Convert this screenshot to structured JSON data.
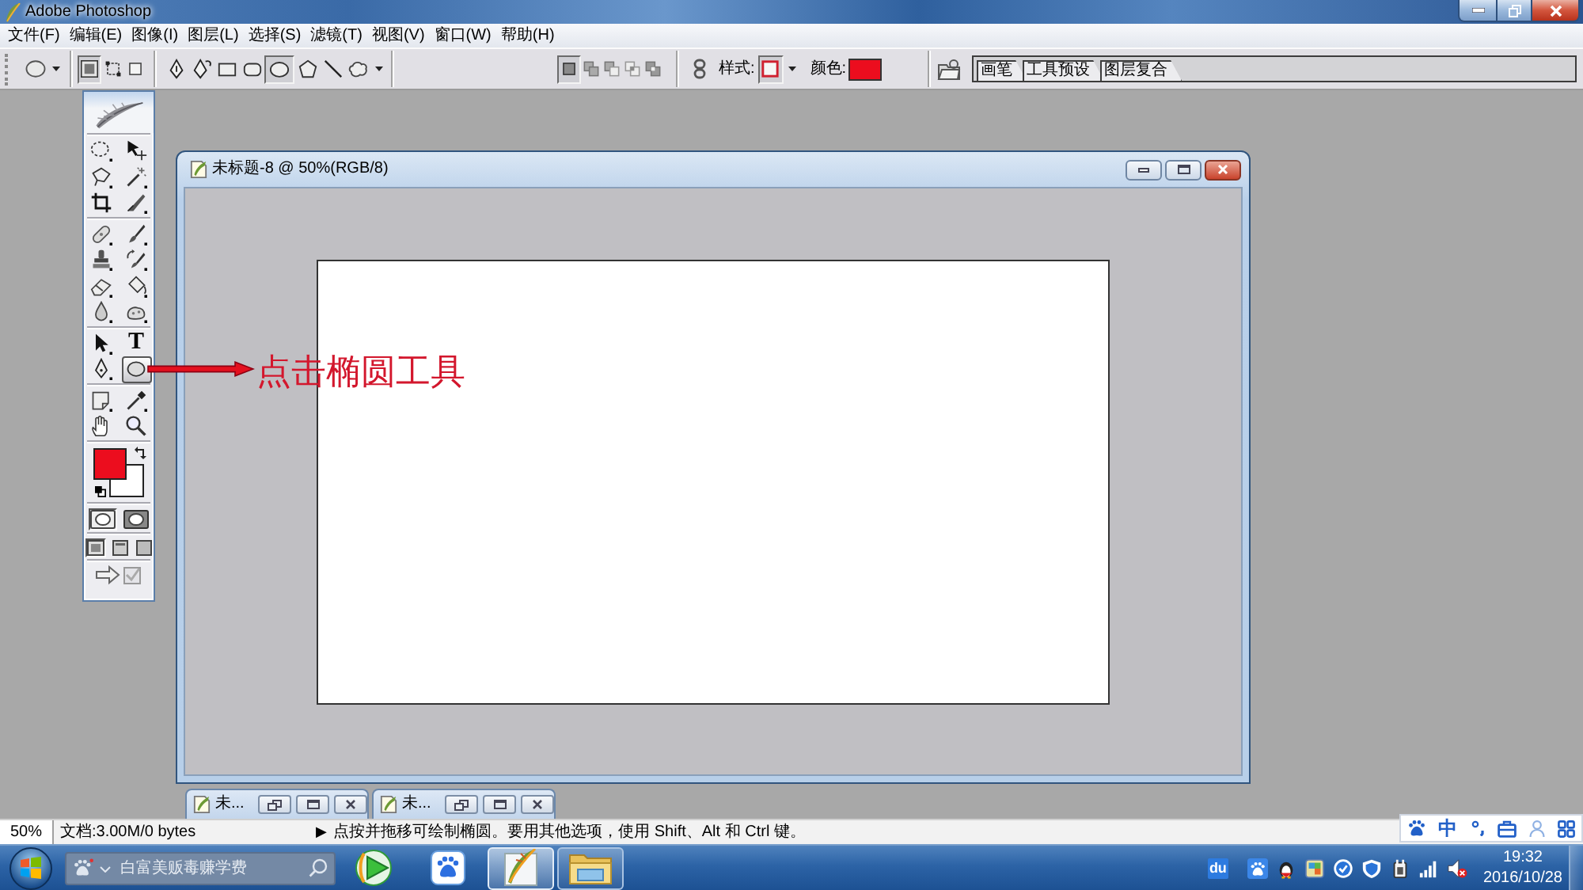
{
  "window": {
    "title": "Adobe Photoshop"
  },
  "menu": [
    "文件(F)",
    "编辑(E)",
    "图像(I)",
    "图层(L)",
    "选择(S)",
    "滤镜(T)",
    "视图(V)",
    "窗口(W)",
    "帮助(H)"
  ],
  "options_bar": {
    "modes": [
      {
        "selected": true
      },
      {
        "selected": false
      },
      {
        "selected": false
      }
    ],
    "shapes": [
      {
        "selected": false
      },
      {
        "selected": false
      },
      {
        "selected": false
      },
      {
        "selected": false
      },
      {
        "selected": true
      },
      {
        "selected": false
      },
      {
        "selected": false
      },
      {
        "selected": false
      }
    ],
    "combine": [
      {
        "selected": true
      },
      {
        "selected": false
      },
      {
        "selected": false
      },
      {
        "selected": false
      },
      {
        "selected": false
      }
    ],
    "style_label": "样式:",
    "color_label": "颜色:",
    "color": "#ec0d1e",
    "palette_tabs": [
      "画笔",
      "工具预设",
      "图层复合"
    ]
  },
  "toolbox": {
    "tools": [
      {
        "selected": false
      },
      {
        "selected": false
      },
      {
        "selected": false
      },
      {
        "selected": false
      },
      {
        "selected": false
      },
      {
        "selected": false
      },
      {
        "selected": false
      },
      {
        "selected": false
      },
      {
        "selected": false
      },
      {
        "selected": false
      },
      {
        "selected": false
      },
      {
        "selected": false
      },
      {
        "selected": false
      },
      {
        "selected": false
      },
      {
        "selected": false
      },
      {
        "selected": false,
        "glyph": "T"
      },
      {
        "selected": false
      },
      {
        "selected": true
      },
      {
        "selected": false
      },
      {
        "selected": false
      },
      {
        "selected": false
      },
      {
        "selected": false
      }
    ],
    "swatches": [
      {
        "color": "#ec0d1e"
      },
      {
        "color": "#ffffff"
      }
    ],
    "mask_modes": [
      {
        "selected": true
      },
      {
        "selected": false
      }
    ],
    "screen_modes": [
      {
        "selected": true
      },
      {
        "selected": false
      },
      {
        "selected": false
      }
    ]
  },
  "document": {
    "title": "未标题-8 @ 50%(RGB/8)"
  },
  "annotation": {
    "text": "点击椭圆工具"
  },
  "minimized_windows": [
    {
      "title": "未..."
    },
    {
      "title": "未..."
    }
  ],
  "status_bar": {
    "zoom": "50%",
    "doc_info": "文档:3.00M/0 bytes",
    "arrow": "▶",
    "message": "点按并拖移可绘制椭圆。要用其他选项，使用 Shift、Alt 和 Ctrl 键。"
  },
  "ime_bar": {
    "mode": "中"
  },
  "taskbar": {
    "search": {
      "placeholder": "白富美贩毒赚学费"
    },
    "apps": [
      {
        "running": false,
        "selected": false
      },
      {
        "running": false,
        "selected": false
      },
      {
        "running": true,
        "selected": true
      },
      {
        "running": true,
        "selected": false
      }
    ],
    "tray_badge": "du",
    "time": "19:32",
    "date": "2016/10/28"
  }
}
